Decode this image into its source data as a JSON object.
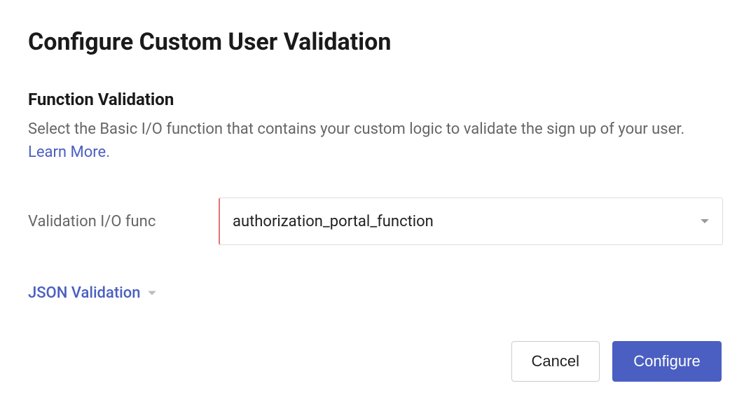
{
  "page": {
    "title": "Configure Custom User Validation"
  },
  "section": {
    "title": "Function Validation",
    "desc_prefix": "Select the Basic I/O function that contains your custom logic to validate the sign up of your user.",
    "learn_more": "Learn More."
  },
  "field": {
    "label": "Validation I/O func",
    "selected": "authorization_portal_function"
  },
  "collapsible": {
    "label": "JSON Validation"
  },
  "buttons": {
    "cancel": "Cancel",
    "configure": "Configure"
  }
}
